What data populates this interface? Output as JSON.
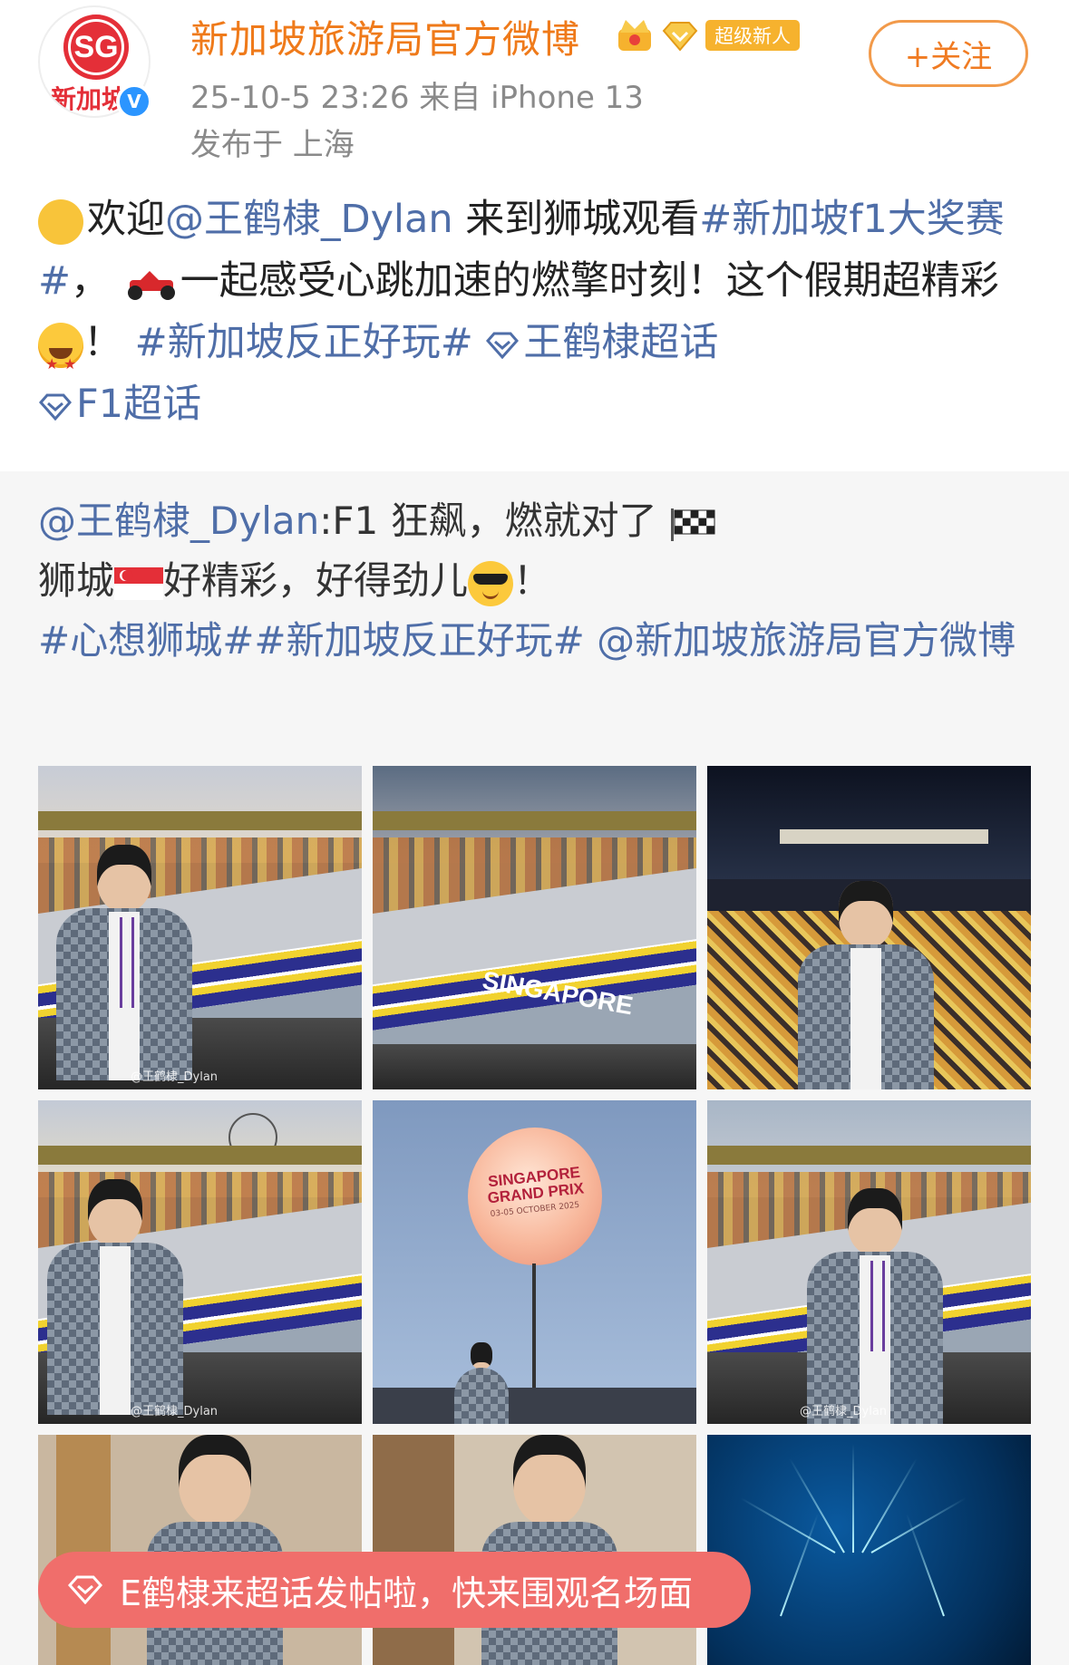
{
  "post": {
    "username": "新加坡旅游局官方微博",
    "super_badge": "超级新人",
    "time_source": "25-10-5 23:26  来自 iPhone 13",
    "location": "发布于 上海",
    "follow_label": "+关注",
    "avatar_logo": "SG",
    "avatar_text": "新加坡",
    "verified_mark": "V",
    "body": {
      "t1": "欢迎",
      "mention": "@王鹤棣_Dylan",
      "t2": " 来到狮城观看",
      "hashtag1": "#新加坡f1大奖赛#",
      "t3": "，",
      "t4": "一起感受心跳加速的燃擎时刻！这个假期超精彩",
      "t5": "！",
      "hashtag2": "#新加坡反正好玩#",
      "supertopic1": "王鹤棣超话",
      "supertopic2": "F1超话"
    }
  },
  "repost": {
    "mention": "@王鹤棣_Dylan",
    "t1": ":F1 狂飙，燃就对了",
    "t2": "狮城",
    "t3": "好精彩，好得劲儿",
    "t4": "！",
    "hashtags": "#心想狮城##新加坡反正好玩#",
    "mention2": "@新加坡旅游局官方微博",
    "photos": [
      {
        "name": "photo-1-track-portrait",
        "watermark": "@王鹤棣_Dylan"
      },
      {
        "name": "photo-2-singapore-curb",
        "watermark": ""
      },
      {
        "name": "photo-3-night-crowd",
        "watermark": ""
      },
      {
        "name": "photo-4-flyer-portrait",
        "watermark": "@王鹤棣_Dylan"
      },
      {
        "name": "photo-5-balloon",
        "watermark": ""
      },
      {
        "name": "photo-6-railing-portrait",
        "watermark": "@王鹤棣_Dylan"
      },
      {
        "name": "photo-7-indoor-closeup",
        "watermark": ""
      },
      {
        "name": "photo-8-indoor-portrait",
        "watermark": ""
      },
      {
        "name": "photo-9-fireworks",
        "watermark": ""
      }
    ],
    "curb_text": "SINGAPORE",
    "balloon_line1": "SINGAPORE",
    "balloon_line2": "GRAND PRIX",
    "balloon_date": "03-05 OCTOBER 2025"
  },
  "toast": {
    "label": "E鹤棣来超话发帖啦，快来围观名场面"
  },
  "colors": {
    "username": "#ef7a1a",
    "link": "#4f6ea8",
    "toast_bg": "#f06e6b",
    "follow_border": "#f29a4a"
  },
  "icons": [
    "crown-icon",
    "vip-diamond-icon",
    "clapping-hands-icon",
    "race-car-icon",
    "star-struck-face-icon",
    "super-topic-diamond-icon",
    "checkered-flag-icon",
    "singapore-flag-icon",
    "sunglasses-face-icon"
  ]
}
